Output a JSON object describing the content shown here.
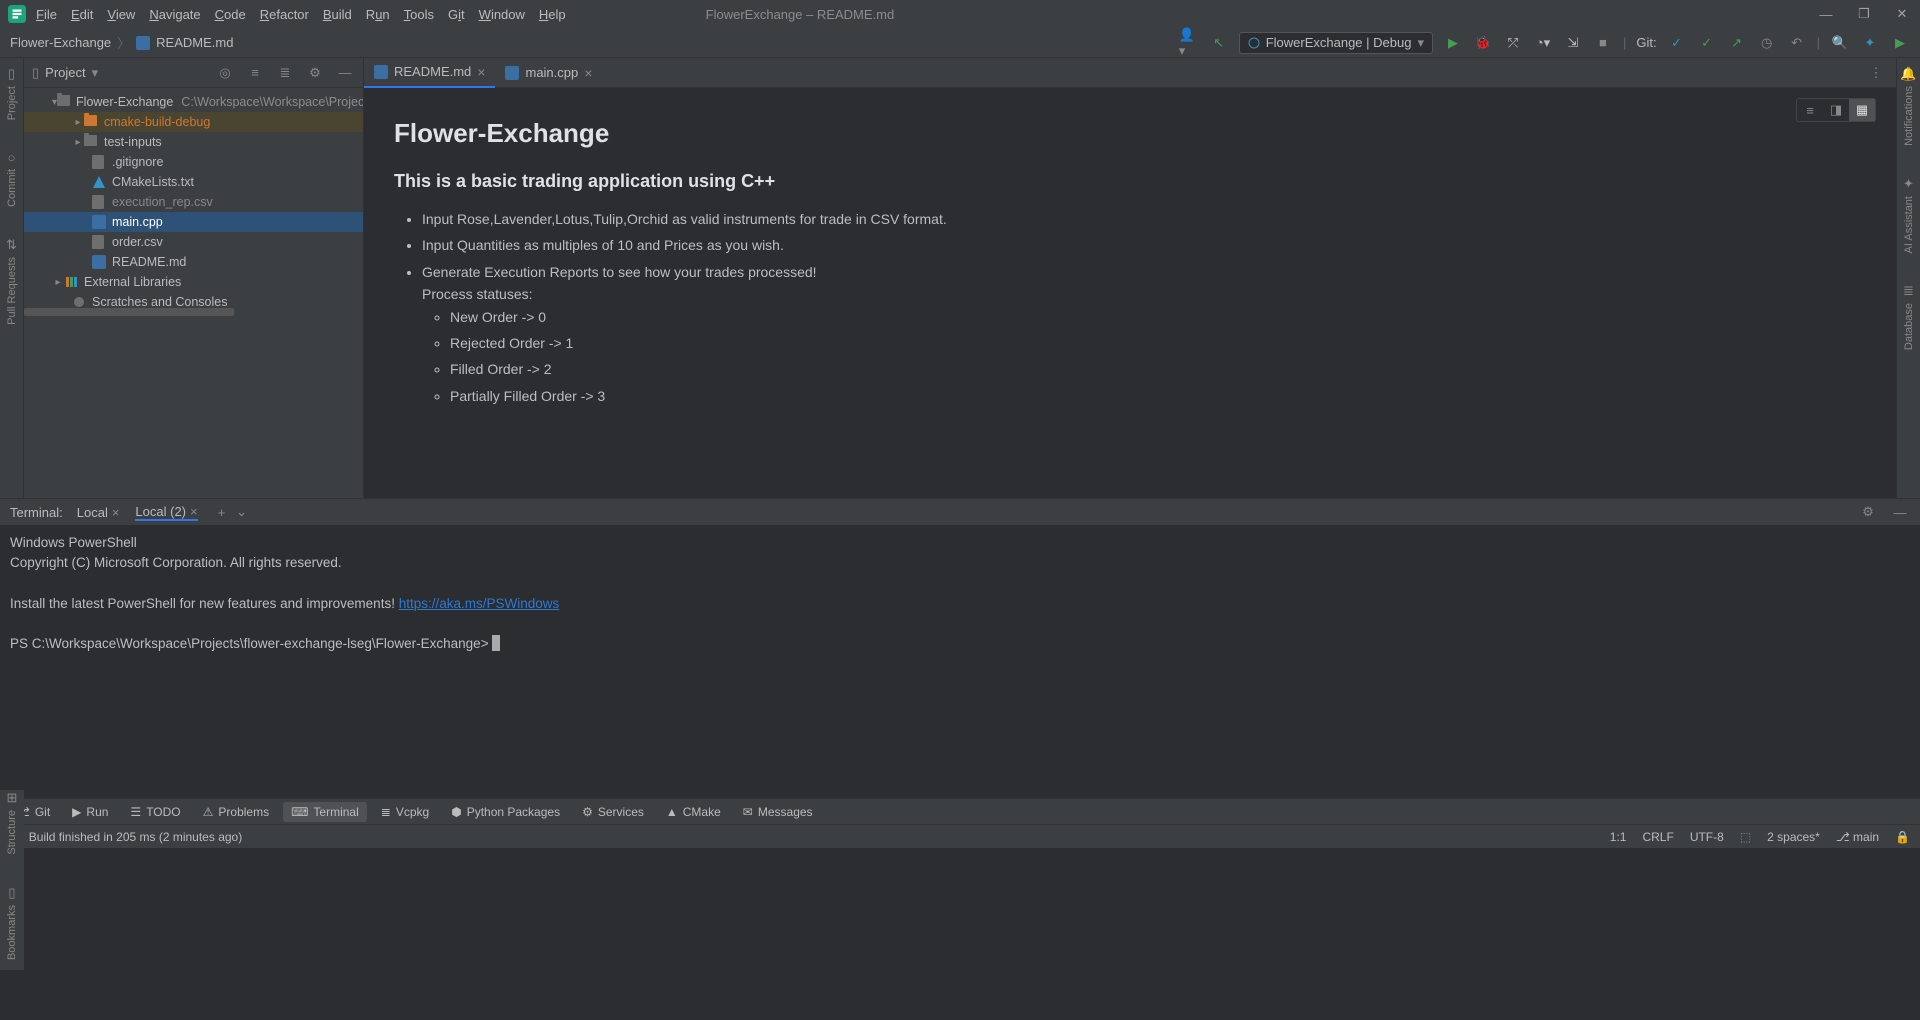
{
  "title_bar": {
    "window_title": "FlowerExchange – README.md",
    "menus": [
      "File",
      "Edit",
      "View",
      "Navigate",
      "Code",
      "Refactor",
      "Build",
      "Run",
      "Tools",
      "Git",
      "Window",
      "Help"
    ]
  },
  "nav": {
    "breadcrumb": [
      "Flower-Exchange",
      "README.md"
    ],
    "run_config": "FlowerExchange | Debug",
    "git_label": "Git:"
  },
  "project": {
    "title": "Project",
    "root": {
      "name": "Flower-Exchange",
      "path": "C:\\Workspace\\Workspace\\Projects\\flow"
    },
    "items": [
      {
        "name": "cmake-build-debug",
        "type": "folder",
        "highlight": true
      },
      {
        "name": "test-inputs",
        "type": "folder"
      },
      {
        "name": ".gitignore",
        "type": "file"
      },
      {
        "name": "CMakeLists.txt",
        "type": "cmake"
      },
      {
        "name": "execution_rep.csv",
        "type": "file",
        "dim": true
      },
      {
        "name": "main.cpp",
        "type": "cpp",
        "selected": true
      },
      {
        "name": "order.csv",
        "type": "file"
      },
      {
        "name": "README.md",
        "type": "md"
      }
    ],
    "ext_lib": "External Libraries",
    "scratches": "Scratches and Consoles"
  },
  "editor": {
    "tabs": [
      {
        "name": "README.md",
        "active": true
      },
      {
        "name": "main.cpp",
        "active": false
      }
    ],
    "md": {
      "h1": "Flower-Exchange",
      "h2": "This is a basic trading application using C++",
      "li1": "Input Rose,Lavender,Lotus,Tulip,Orchid as valid instruments for trade in CSV format.",
      "li2": "Input Quantities as multiples of 10 and Prices as you wish.",
      "li3": "Generate Execution Reports to see how your trades processed!",
      "li3b": "Process statuses:",
      "sub": [
        "New Order -> 0",
        "Rejected Order -> 1",
        "Filled Order -> 2",
        "Partially Filled Order -> 3"
      ]
    }
  },
  "terminal": {
    "label": "Terminal:",
    "tabs": [
      "Local",
      "Local (2)"
    ],
    "lines": {
      "l1": "Windows PowerShell",
      "l2": "Copyright (C) Microsoft Corporation. All rights reserved.",
      "l3": "Install the latest PowerShell for new features and improvements! ",
      "link": "https://aka.ms/PSWindows",
      "prompt": "PS C:\\Workspace\\Workspace\\Projects\\flower-exchange-lseg\\Flower-Exchange> "
    }
  },
  "bottom_tabs": [
    "Git",
    "Run",
    "TODO",
    "Problems",
    "Terminal",
    "Vcpkg",
    "Python Packages",
    "Services",
    "CMake",
    "Messages"
  ],
  "status": {
    "msg": "Build finished in 205 ms (2 minutes ago)",
    "pos": "1:1",
    "eol": "CRLF",
    "enc": "UTF-8",
    "indent": "2 spaces*",
    "branch": "main"
  },
  "left_gutter": [
    "Project",
    "Commit",
    "Pull Requests"
  ],
  "right_gutter": [
    "Notifications",
    "AI Assistant",
    "Database"
  ]
}
